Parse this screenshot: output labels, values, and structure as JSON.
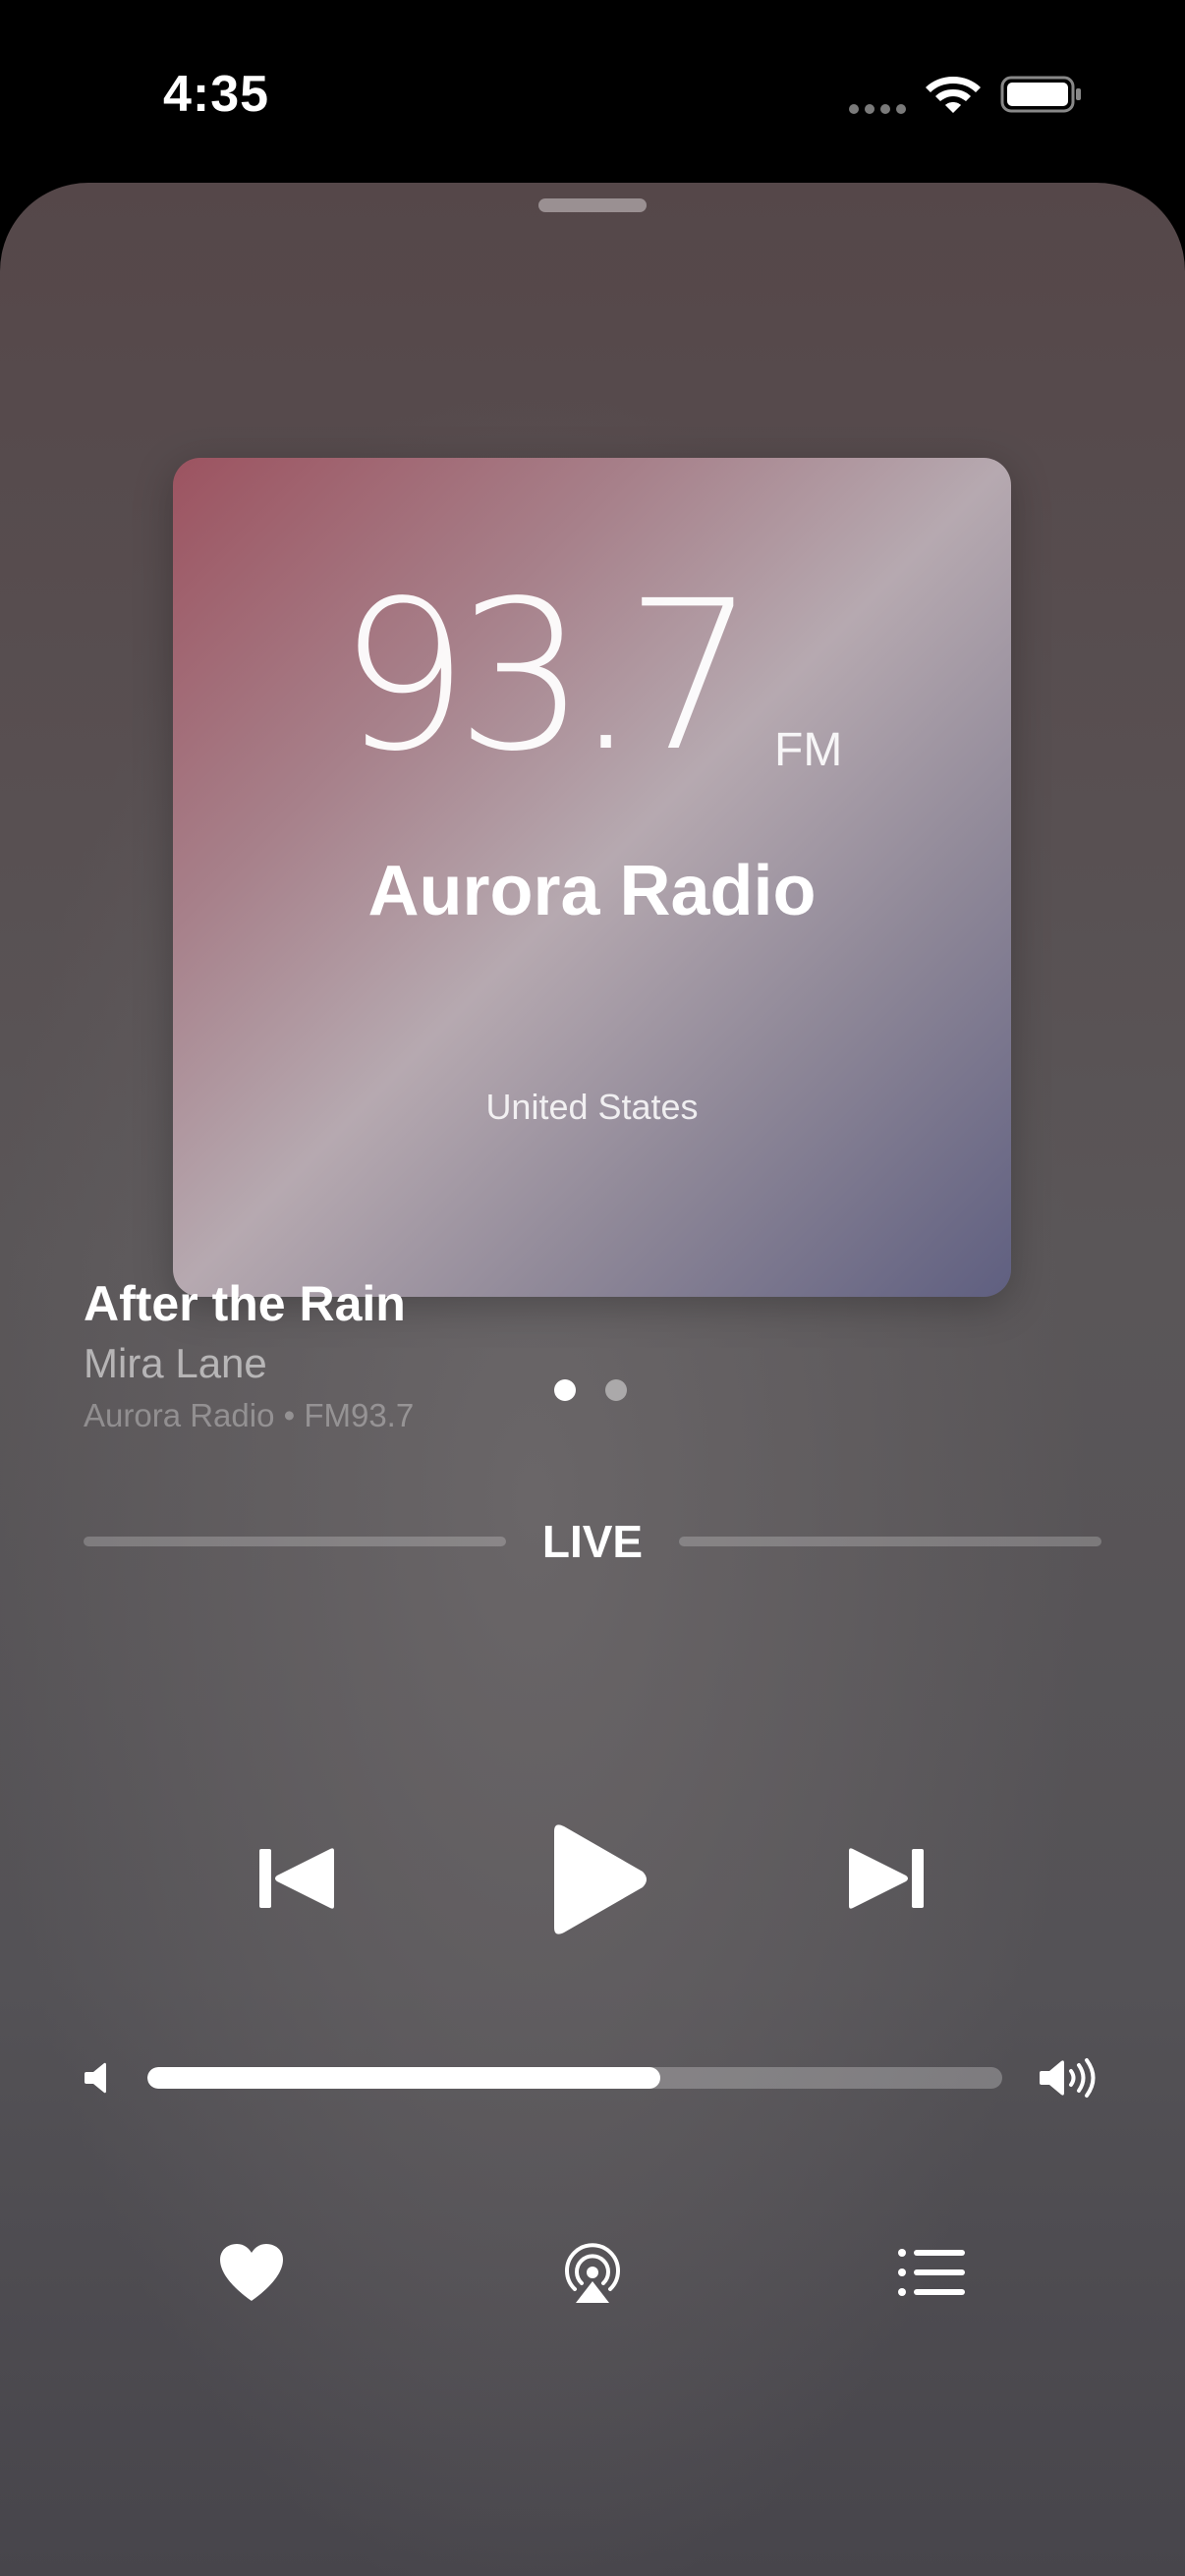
{
  "status_bar": {
    "time": "4:35",
    "icons": [
      "signal-dots-icon",
      "wifi-icon",
      "battery-icon"
    ]
  },
  "now_playing": {
    "artwork": {
      "frequency": "93.7",
      "band": "FM",
      "station_name": "Aurora Radio",
      "country": "United States",
      "gradient_colors": [
        "#9c5360",
        "#b6a9b0",
        "#5f5f80"
      ]
    },
    "pages": {
      "count": 2,
      "active_index": 0
    },
    "track": {
      "title": "After the Rain",
      "artist": "Mira Lane",
      "meta": "Aurora Radio • FM93.7"
    },
    "live_label": "LIVE",
    "controls": {
      "previous": "previous-track-icon",
      "play": "play-icon",
      "next": "next-track-icon"
    },
    "volume": {
      "level": 0.6,
      "low_icon": "speaker-low-icon",
      "high_icon": "speaker-high-icon"
    },
    "actions": {
      "favorite": "heart-icon",
      "airplay": "airplay-icon",
      "queue": "list-icon"
    }
  }
}
